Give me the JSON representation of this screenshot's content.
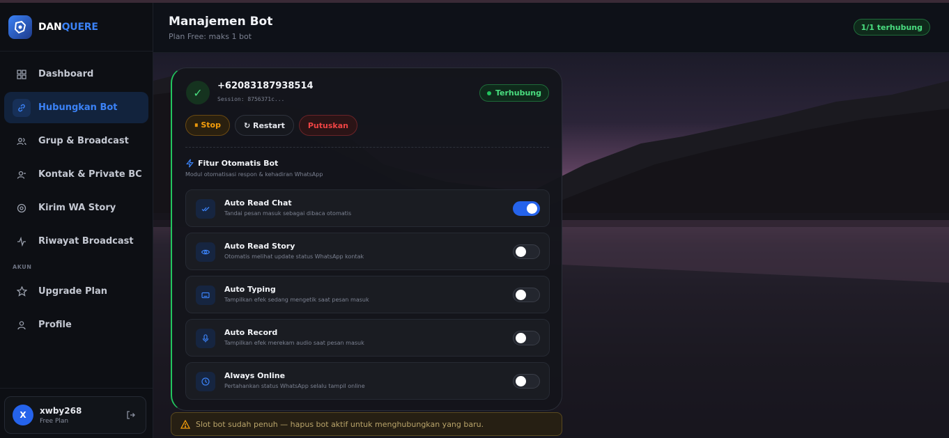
{
  "brand": {
    "name_a": "DAN",
    "name_b": "QUERE"
  },
  "sidebar": {
    "items": [
      {
        "label": "Dashboard",
        "icon": "grid-icon"
      },
      {
        "label": "Hubungkan Bot",
        "icon": "link-icon",
        "active": true
      },
      {
        "label": "Grup & Broadcast",
        "icon": "users-icon"
      },
      {
        "label": "Kontak & Private BC",
        "icon": "user-icon"
      },
      {
        "label": "Kirim WA Story",
        "icon": "story-icon"
      },
      {
        "label": "Riwayat Broadcast",
        "icon": "activity-icon"
      }
    ],
    "section_label": "AKUN",
    "account_items": [
      {
        "label": "Upgrade Plan",
        "icon": "star-icon"
      },
      {
        "label": "Profile",
        "icon": "user-icon"
      }
    ],
    "user": {
      "initial": "X",
      "name": "xwby268",
      "plan": "Free Plan"
    }
  },
  "header": {
    "title": "Manajemen Bot",
    "subtitle": "Plan Free: maks 1 bot",
    "badge": "1/1 terhubung"
  },
  "bot": {
    "phone": "+62083187938514",
    "session": "Session: 8756371c...",
    "status": "Terhubung",
    "buttons": {
      "stop": "⏸ Stop",
      "restart": "↻ Restart",
      "disconnect": "Putuskan"
    },
    "features_title": "Fitur Otomatis Bot",
    "features_subtitle": "Modul otomatisasi respon & kehadiran WhatsApp",
    "features": [
      {
        "name": "Auto Read Chat",
        "desc": "Tandai pesan masuk sebagai dibaca otomatis",
        "enabled": true,
        "icon": "double-check-icon"
      },
      {
        "name": "Auto Read Story",
        "desc": "Otomatis melihat update status WhatsApp kontak",
        "enabled": false,
        "icon": "eye-icon"
      },
      {
        "name": "Auto Typing",
        "desc": "Tampilkan efek sedang mengetik saat pesan masuk",
        "enabled": false,
        "icon": "keyboard-icon"
      },
      {
        "name": "Auto Record",
        "desc": "Tampilkan efek merekam audio saat pesan masuk",
        "enabled": false,
        "icon": "mic-icon"
      },
      {
        "name": "Always Online",
        "desc": "Pertahankan status WhatsApp selalu tampil online",
        "enabled": false,
        "icon": "clock-icon"
      }
    ]
  },
  "warning": "Slot bot sudah penuh — hapus bot aktif untuk menghubungkan yang baru.",
  "colors": {
    "accent": "#3b82f6",
    "success": "#22c55e",
    "warning": "#f59e0b",
    "danger": "#ef4444"
  }
}
